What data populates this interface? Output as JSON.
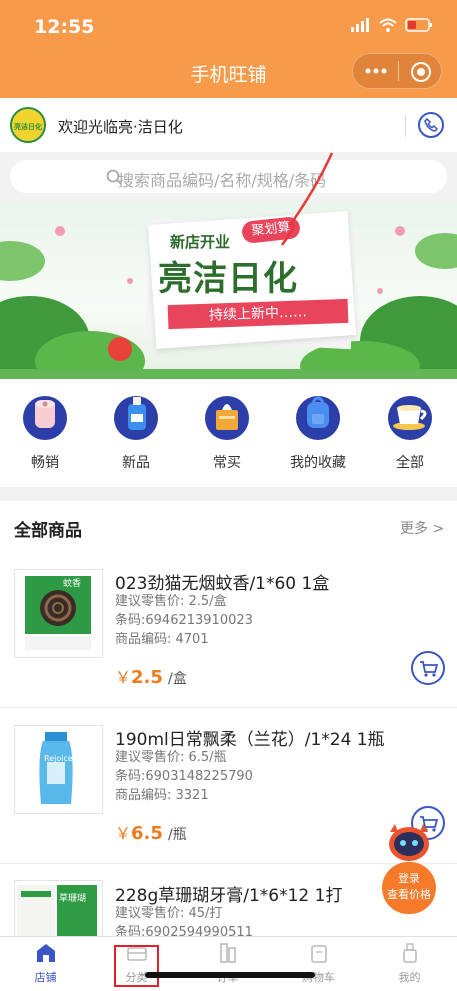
{
  "status_bar": {
    "time": "12:55"
  },
  "header": {
    "title": "手机旺铺"
  },
  "store": {
    "welcome": "欢迎光临亮·洁日化",
    "logo_text": "亮洁日化"
  },
  "search": {
    "placeholder": "搜索商品编码/名称/规格/条码"
  },
  "banner": {
    "tag": "聚划算",
    "opening": "新店开业",
    "headline": "亮洁日化",
    "ribbon": "持续上新中……"
  },
  "categories": [
    {
      "label": "畅销",
      "icon": "toilet-paper-icon"
    },
    {
      "label": "新品",
      "icon": "bottle-icon"
    },
    {
      "label": "常买",
      "icon": "tissue-box-icon"
    },
    {
      "label": "我的收藏",
      "icon": "backpack-icon"
    },
    {
      "label": "全部",
      "icon": "cup-icon"
    }
  ],
  "product_list": {
    "title": "全部商品",
    "more": "更多 >",
    "items": [
      {
        "name": "023劲猫无烟蚊香/1*60 1盒",
        "retail": "建议零售价: 2.5/盒",
        "barcode": "条码:6946213910023",
        "code": "商品编码: 4701",
        "currency": "￥",
        "price": "2.5",
        "unit": "/盒",
        "img_label": "蚊香"
      },
      {
        "name": "190ml日常飘柔（兰花）/1*24 1瓶",
        "retail": "建议零售价: 6.5/瓶",
        "barcode": "条码:6903148225790",
        "code": "商品编码: 3321",
        "currency": "￥",
        "price": "6.5",
        "unit": "/瓶",
        "img_label": "Rejoice"
      },
      {
        "name": "228g草珊瑚牙膏/1*6*12 1打",
        "retail": "建议零售价: 45/打",
        "barcode": "条码:6902594990511",
        "code": "",
        "currency": "",
        "price": "",
        "unit": "",
        "img_label": "草珊瑚"
      }
    ]
  },
  "float_login": {
    "line1": "登录",
    "line2": "查看价格"
  },
  "tabbar": [
    {
      "label": "店铺",
      "active": true
    },
    {
      "label": "分类",
      "active": false
    },
    {
      "label": "订单",
      "active": false
    },
    {
      "label": "购物车",
      "active": false
    },
    {
      "label": "我的",
      "active": false
    }
  ],
  "colors": {
    "accent": "#f79a4a",
    "price": "#f07b1f",
    "brand_blue": "#3b57c4",
    "highlight_box": "#e0202a"
  }
}
